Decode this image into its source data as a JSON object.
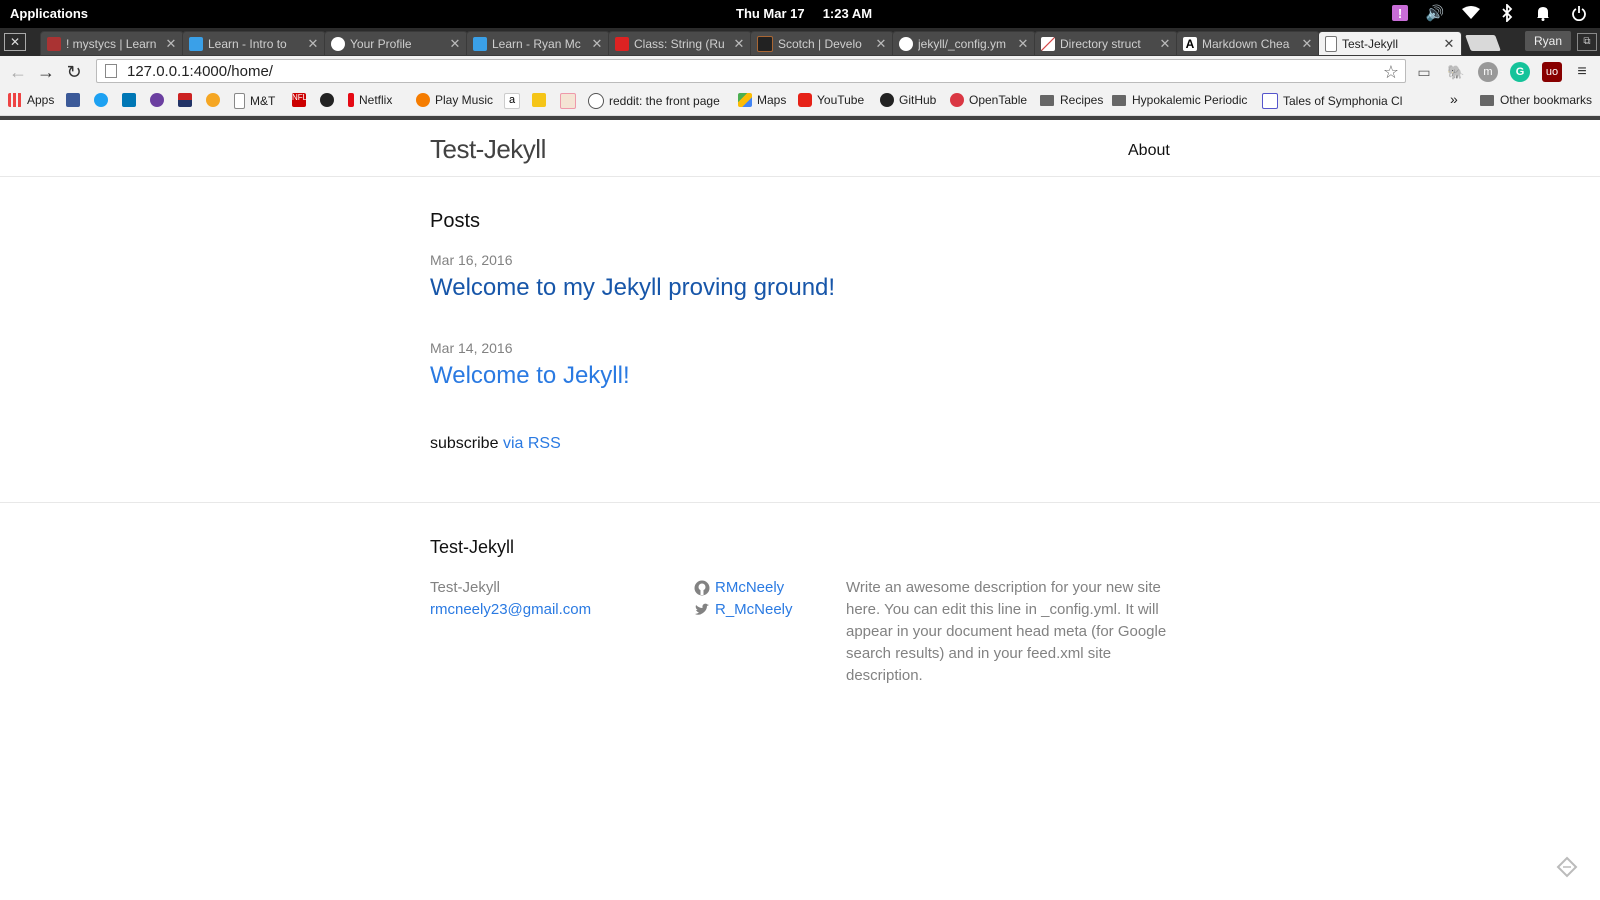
{
  "os_panel": {
    "applications_label": "Applications",
    "date": "Thu Mar 17",
    "time": "1:23 AM",
    "tray_icons": [
      "notification-alert-icon",
      "volume-icon",
      "wifi-icon",
      "bluetooth-icon",
      "bell-icon",
      "power-icon"
    ]
  },
  "browser": {
    "tabs": [
      {
        "title": "! mystycs | Learn",
        "icon": "mystycs-favicon"
      },
      {
        "title": "Learn - Intro to",
        "icon": "learn-favicon"
      },
      {
        "title": "Your Profile",
        "icon": "github-icon"
      },
      {
        "title": "Learn - Ryan Mc",
        "icon": "learn-favicon"
      },
      {
        "title": "Class: String (Ru",
        "icon": "ruby-icon"
      },
      {
        "title": "Scotch | Develo",
        "icon": "scotch-favicon"
      },
      {
        "title": "jekyll/_config.ym",
        "icon": "github-icon"
      },
      {
        "title": "Directory struct",
        "icon": "jekyll-favicon"
      },
      {
        "title": "Markdown Chea",
        "icon": "markdown-favicon"
      },
      {
        "title": "Test-Jekyll",
        "icon": "page-icon",
        "active": true
      }
    ],
    "profile_name": "Ryan",
    "url_host": "127.0.0.1",
    "url_path": ":4000/home/",
    "url": "127.0.0.1:4000/home/",
    "bookmarks": {
      "apps": "Apps",
      "mt": "M&T",
      "netflix": "Netflix",
      "play_music": "Play Music",
      "reddit": "reddit: the front page",
      "maps": "Maps",
      "youtube": "YouTube",
      "github": "GitHub",
      "opentable": "OpenTable",
      "recipes": "Recipes",
      "hypokalemic": "Hypokalemic Periodic",
      "tales": "Tales of Symphonia Cl",
      "overflow": "»",
      "other": "Other bookmarks"
    }
  },
  "site": {
    "title": "Test-Jekyll",
    "nav_about": "About",
    "posts_heading": "Posts",
    "posts": [
      {
        "date": "Mar 16, 2016",
        "title": "Welcome to my Jekyll proving ground!"
      },
      {
        "date": "Mar 14, 2016",
        "title": "Welcome to Jekyll!"
      }
    ],
    "subscribe_text": "subscribe",
    "subscribe_link": "via RSS",
    "footer": {
      "heading": "Test-Jekyll",
      "name": "Test-Jekyll",
      "email": "rmcneely23@gmail.com",
      "github_user": "RMcNeely",
      "twitter_user": "R_McNeely",
      "description": "Write an awesome description for your new site here. You can edit this line in _config.yml. It will appear in your document head meta (for Google search results) and in your feed.xml site description."
    }
  },
  "colors": {
    "link": "#2a7ae2",
    "visited_link": "#1756a9",
    "meta_gray": "#828282",
    "header_bar": "#424242"
  }
}
